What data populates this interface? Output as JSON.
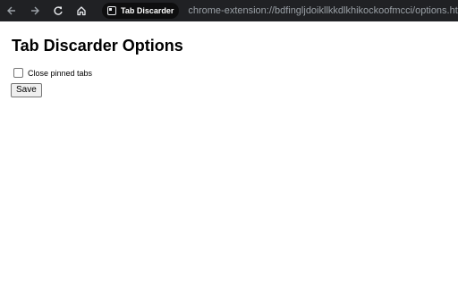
{
  "browser": {
    "back_icon": "arrow-left-icon",
    "forward_icon": "arrow-right-icon",
    "reload_icon": "reload-icon",
    "home_icon": "home-icon",
    "tab_chip_label": "Tab Discarder",
    "url": "chrome-extension://bdfingljdoikllkkdlkhikockoofmcci/options.html"
  },
  "page": {
    "title": "Tab Discarder Options",
    "option_label": "Close pinned tabs",
    "option_checked": false,
    "save_label": "Save"
  },
  "colors": {
    "toolbar_bg": "#202124",
    "url_text": "#9aa0a6",
    "page_bg": "#ffffff"
  }
}
